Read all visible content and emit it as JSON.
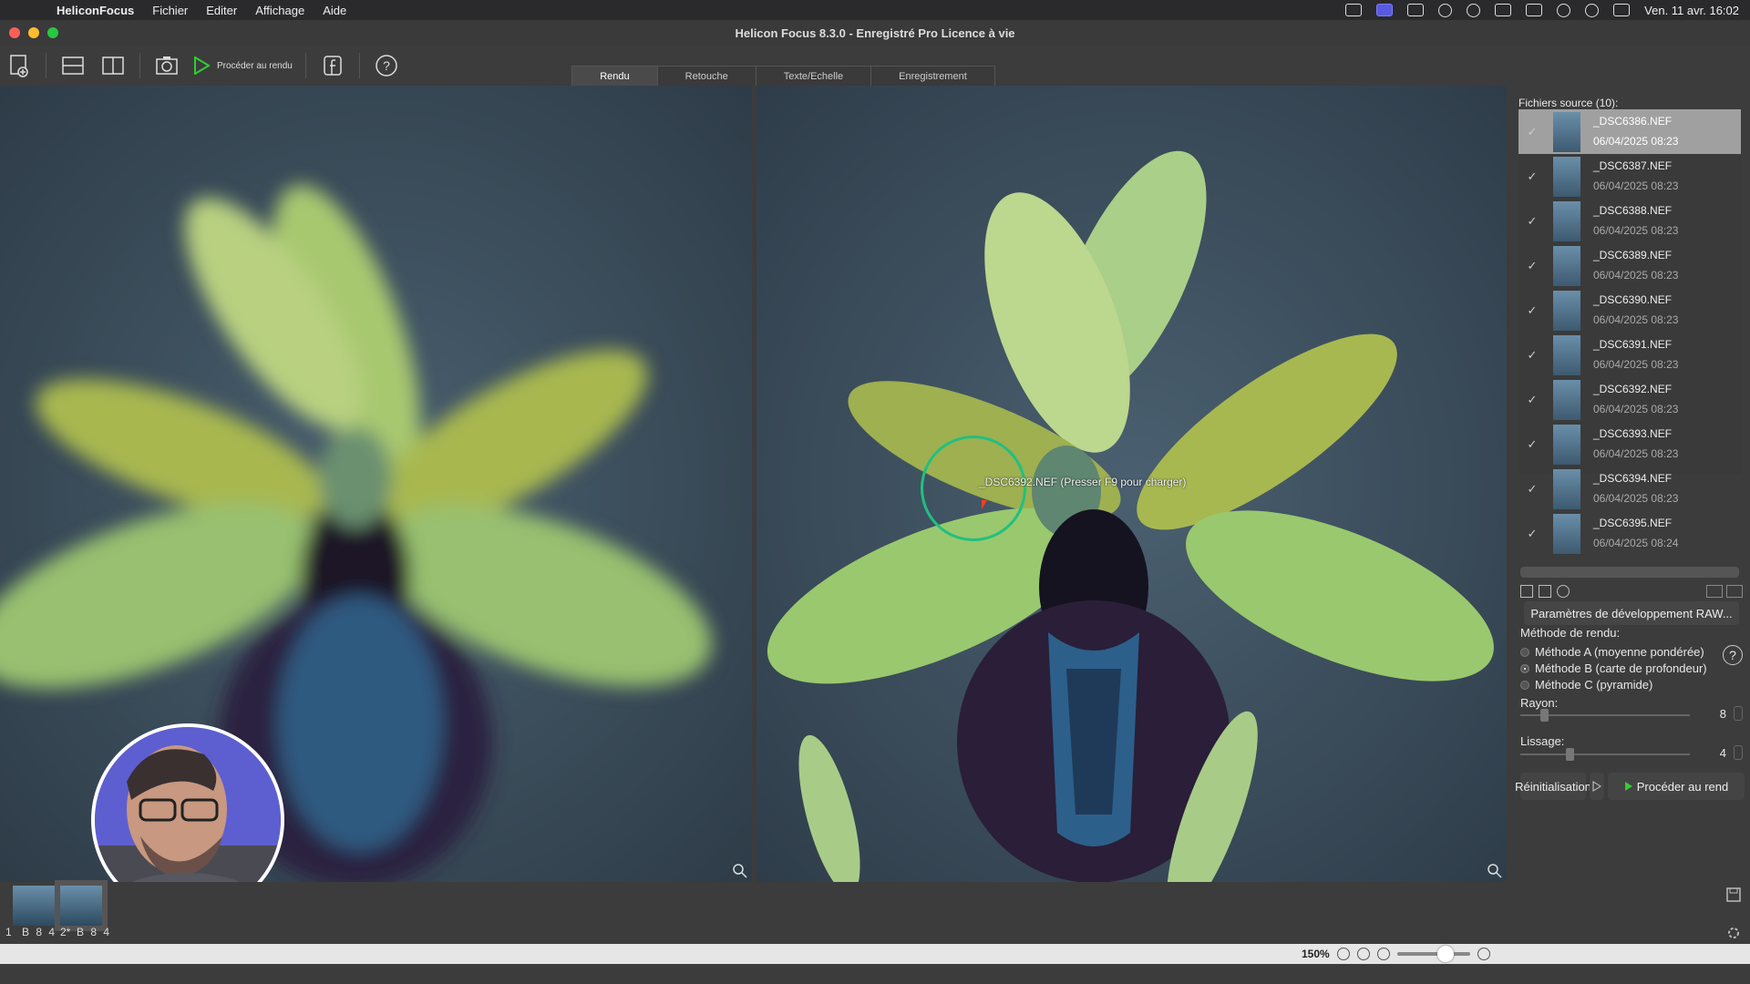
{
  "menubar": {
    "app": "HeliconFocus",
    "items": [
      "Fichier",
      "Editer",
      "Affichage",
      "Aide"
    ],
    "clock": "Ven. 11 avr.  16:02"
  },
  "window": {
    "title": "Helicon Focus 8.3.0 - Enregistré Pro Licence à vie"
  },
  "toolbar": {
    "render_label": "Procéder au rendu"
  },
  "tabs": [
    "Rendu",
    "Retouche",
    "Texte/Echelle",
    "Enregistrement"
  ],
  "active_tab": "Rendu",
  "viewer": {
    "tooltip": "_DSC6392.NEF (Presser F9 pour charger)"
  },
  "sidebar": {
    "title": "Fichiers source (10):",
    "files": [
      {
        "name": "_DSC6386.NEF",
        "date": "06/04/2025 08:23",
        "checked": true,
        "selected": true
      },
      {
        "name": "_DSC6387.NEF",
        "date": "06/04/2025 08:23",
        "checked": true
      },
      {
        "name": "_DSC6388.NEF",
        "date": "06/04/2025 08:23",
        "checked": true
      },
      {
        "name": "_DSC6389.NEF",
        "date": "06/04/2025 08:23",
        "checked": true
      },
      {
        "name": "_DSC6390.NEF",
        "date": "06/04/2025 08:23",
        "checked": true
      },
      {
        "name": "_DSC6391.NEF",
        "date": "06/04/2025 08:23",
        "checked": true
      },
      {
        "name": "_DSC6392.NEF",
        "date": "06/04/2025 08:23",
        "checked": true
      },
      {
        "name": "_DSC6393.NEF",
        "date": "06/04/2025 08:23",
        "checked": true
      },
      {
        "name": "_DSC6394.NEF",
        "date": "06/04/2025 08:23",
        "checked": true
      },
      {
        "name": "_DSC6395.NEF",
        "date": "06/04/2025 08:24",
        "checked": true
      }
    ],
    "raw_button": "Paramètres de développement RAW...",
    "method_title": "Méthode de rendu:",
    "methods": [
      "Méthode A (moyenne pondérée)",
      "Méthode B (carte de profondeur)",
      "Méthode C (pyramide)"
    ],
    "selected_method": 1,
    "radius_label": "Rayon:",
    "radius_value": "8",
    "smoothing_label": "Lissage:",
    "smoothing_value": "4",
    "reset_button": "Réinitialisation",
    "render_button": "Procéder au rend"
  },
  "strip": {
    "thumbs": [
      {
        "index": "1",
        "label": "B 8 4"
      },
      {
        "index": "2*",
        "label": "B 8 4"
      }
    ]
  },
  "status": {
    "zoom": "150%"
  }
}
